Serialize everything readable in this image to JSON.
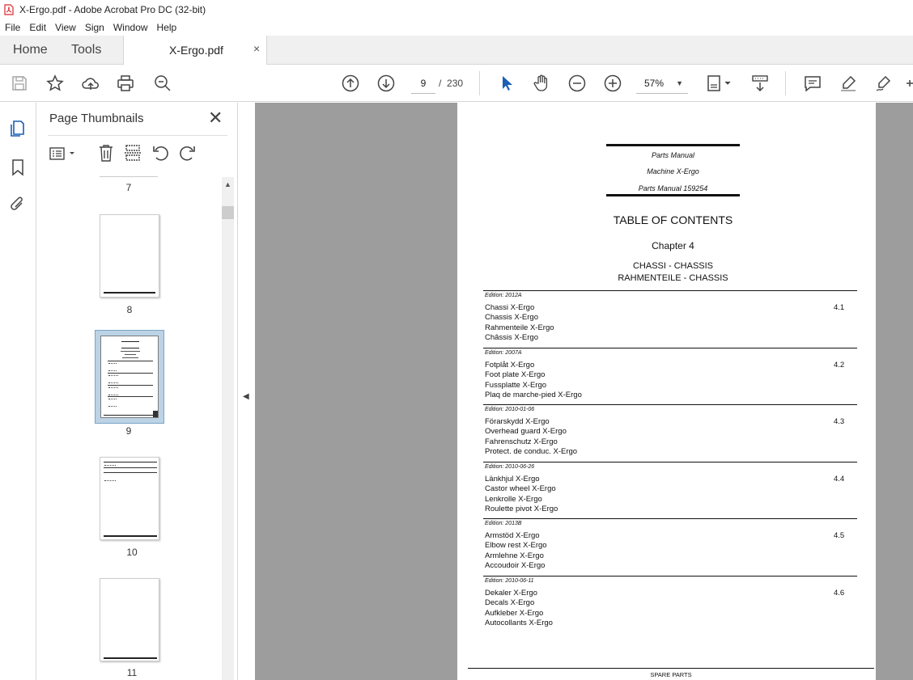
{
  "window": {
    "title": "X-Ergo.pdf - Adobe Acrobat Pro DC (32-bit)"
  },
  "menu": [
    "File",
    "Edit",
    "View",
    "Sign",
    "Window",
    "Help"
  ],
  "tabs": {
    "home": "Home",
    "tools": "Tools",
    "document": "X-Ergo.pdf",
    "close": "×"
  },
  "toolbar": {
    "page_current": "9",
    "page_separator": "/",
    "page_total": "230",
    "zoom": "57%"
  },
  "thumbnails_panel": {
    "title": "Page Thumbnails",
    "close": "✕",
    "pages": [
      {
        "number": "7"
      },
      {
        "number": "8"
      },
      {
        "number": "9",
        "selected": true
      },
      {
        "number": "10"
      },
      {
        "number": "11"
      }
    ]
  },
  "document": {
    "header_lines": [
      "Parts Manual",
      "Machine X-Ergo",
      "Parts Manual 159254"
    ],
    "toc_title": "TABLE OF CONTENTS",
    "chapter": "Chapter 4",
    "subtitle_lines": [
      "CHASSI - CHASSIS",
      "RAHMENTEILE - CHASSIS"
    ],
    "sections": [
      {
        "edition": "Edition: 2012A",
        "number": "4.1",
        "lines": [
          "Chassi X-Ergo",
          "Chassis X-Ergo",
          "Rahmenteile X-Ergo",
          "Châssis X-Ergo"
        ]
      },
      {
        "edition": "Edition: 2007A",
        "number": "4.2",
        "lines": [
          "Fotplåt X-Ergo",
          "Foot plate X-Ergo",
          "Fussplatte X-Ergo",
          "Plaq de marche-pied X-Ergo"
        ]
      },
      {
        "edition": "Edition: 2010-01-06",
        "number": "4.3",
        "lines": [
          "Förarskydd X-Ergo",
          "Overhead guard X-Ergo",
          "Fahrenschutz X-Ergo",
          "Protect. de conduc. X-Ergo"
        ]
      },
      {
        "edition": "Edition: 2010-06-26",
        "number": "4.4",
        "lines": [
          "Länkhjul X-Ergo",
          "Castor wheel X-Ergo",
          "Lenkrolle X-Ergo",
          "Roulette pivot X-Ergo"
        ]
      },
      {
        "edition": "Edition: 2013B",
        "number": "4.5",
        "lines": [
          "Armstöd X-Ergo",
          "Elbow rest X-Ergo",
          "Armlehne X-Ergo",
          "Accoudoir X-Ergo"
        ]
      },
      {
        "edition": "Edition: 2010-06-11",
        "number": "4.6",
        "lines": [
          "Dekaler X-Ergo",
          "Decals X-Ergo",
          "Aufkleber X-Ergo",
          "Autocollants X-Ergo"
        ]
      }
    ],
    "footer": "SPARE PARTS"
  },
  "colors": {
    "acrobat_red": "#d7282f",
    "selected_thumb_bg": "#bcd3e6",
    "viewer_bg": "#9d9d9d",
    "cursor_blue": "#1a5fb4"
  }
}
